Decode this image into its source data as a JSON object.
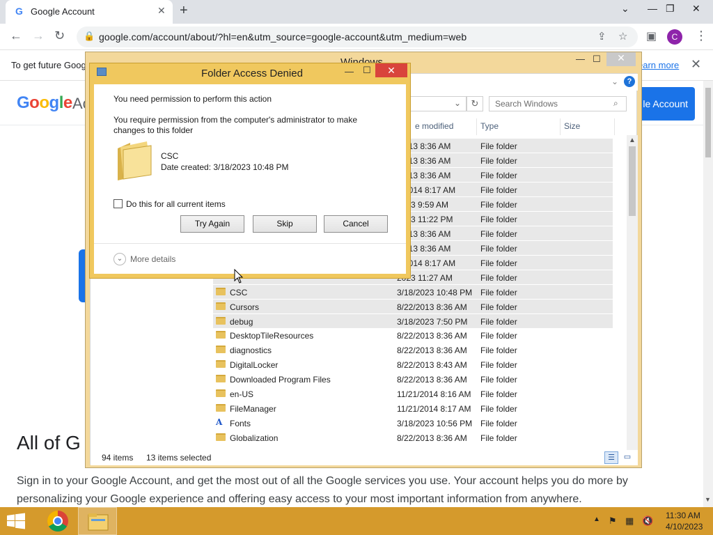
{
  "browser": {
    "tab_title": "Google Account",
    "tab_favicon": "G",
    "url": "google.com/account/about/?hl=en&utm_source=google-account&utm_medium=web",
    "avatar_letter": "C"
  },
  "infobar": {
    "text": "To get future Goog",
    "learn_more": "earn more"
  },
  "page": {
    "logo": "Google",
    "account_partial": "Ac",
    "cta_button": "le Account",
    "heading_partial": "All of G",
    "paragraph": "Sign in to your Google Account, and get the most out of all the Google services you use. Your account helps you do more by personalizing your Google experience and offering easy access to your most important information from anywhere."
  },
  "explorer": {
    "title": "Windows",
    "search_placeholder": "Search Windows",
    "columns": {
      "date": "e modified",
      "type": "Type",
      "size": "Size"
    },
    "rows": [
      {
        "name": "",
        "date": "/2013 8:36 AM",
        "type": "File folder",
        "selected": true
      },
      {
        "name": "",
        "date": "/2013 8:36 AM",
        "type": "File folder",
        "selected": true
      },
      {
        "name": "",
        "date": "/2013 8:36 AM",
        "type": "File folder",
        "selected": true
      },
      {
        "name": "",
        "date": "1/2014 8:17 AM",
        "type": "File folder",
        "selected": true
      },
      {
        "name": "",
        "date": "2023 9:59 AM",
        "type": "File folder",
        "selected": true
      },
      {
        "name": "",
        "date": "2023 11:22 PM",
        "type": "File folder",
        "selected": true
      },
      {
        "name": "",
        "date": "/2013 8:36 AM",
        "type": "File folder",
        "selected": true
      },
      {
        "name": "",
        "date": "/2013 8:36 AM",
        "type": "File folder",
        "selected": true
      },
      {
        "name": "",
        "date": "1/2014 8:17 AM",
        "type": "File folder",
        "selected": true
      },
      {
        "name": "",
        "date": "2023 11:27 AM",
        "type": "File folder",
        "selected": true
      },
      {
        "name": "CSC",
        "date": "3/18/2023 10:48 PM",
        "type": "File folder",
        "selected": true
      },
      {
        "name": "Cursors",
        "date": "8/22/2013 8:36 AM",
        "type": "File folder",
        "selected": true
      },
      {
        "name": "debug",
        "date": "3/18/2023 7:50 PM",
        "type": "File folder",
        "selected": true
      },
      {
        "name": "DesktopTileResources",
        "date": "8/22/2013 8:36 AM",
        "type": "File folder",
        "selected": false
      },
      {
        "name": "diagnostics",
        "date": "8/22/2013 8:36 AM",
        "type": "File folder",
        "selected": false
      },
      {
        "name": "DigitalLocker",
        "date": "8/22/2013 8:43 AM",
        "type": "File folder",
        "selected": false
      },
      {
        "name": "Downloaded Program Files",
        "date": "8/22/2013 8:36 AM",
        "type": "File folder",
        "selected": false
      },
      {
        "name": "en-US",
        "date": "11/21/2014 8:16 AM",
        "type": "File folder",
        "selected": false
      },
      {
        "name": "FileManager",
        "date": "11/21/2014 8:17 AM",
        "type": "File folder",
        "selected": false
      },
      {
        "name": "Fonts",
        "date": "3/18/2023 10:56 PM",
        "type": "File folder",
        "selected": false,
        "icon": "font-icon"
      },
      {
        "name": "Globalization",
        "date": "8/22/2013 8:36 AM",
        "type": "File folder",
        "selected": false
      }
    ],
    "status_items": "94 items",
    "status_selected": "13 items selected"
  },
  "dialog": {
    "title": "Folder Access Denied",
    "line1": "You need permission to perform this action",
    "line2": "You require permission from the computer's administrator to make changes to this folder",
    "folder_name": "CSC",
    "folder_date": "Date created: 3/18/2023 10:48 PM",
    "checkbox_label": "Do this for all current items",
    "btn_try": "Try Again",
    "btn_skip": "Skip",
    "btn_cancel": "Cancel",
    "more_details": "More details"
  },
  "taskbar": {
    "time": "11:30 AM",
    "date": "4/10/2023"
  },
  "colors": {
    "accent_blue": "#1a73e8",
    "frame_orange": "#f0c85e",
    "taskbar": "#d59a2c",
    "close_red": "#d9443c"
  }
}
